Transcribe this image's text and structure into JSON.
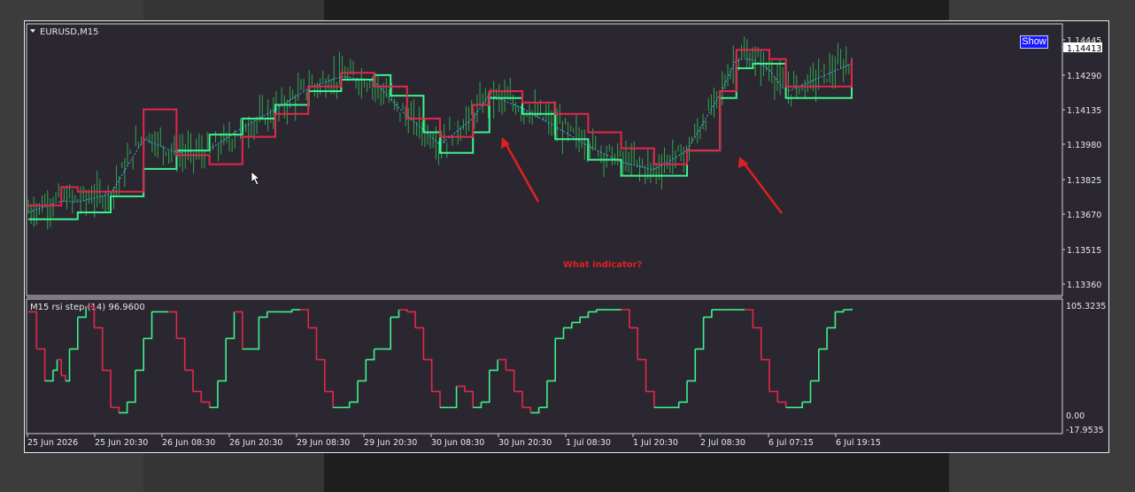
{
  "window": {
    "symbol_label": "EURUSD,M15",
    "indicator_label": "M15 rsi step (14) 96.9600",
    "show_button": "Show",
    "annotation_text": "What indicator?"
  },
  "colors": {
    "background": "#2b2730",
    "candle": "#2fa84f",
    "green_line": "#3cf28c",
    "red_line": "#e0284a",
    "annotation": "#e02020"
  },
  "chart_data": [
    {
      "type": "line",
      "title": "EURUSD,M15",
      "y_ticks": [
        "1.14445",
        "1.14413",
        "1.14290",
        "1.14135",
        "1.13980",
        "1.13825",
        "1.13670",
        "1.13515",
        "1.13360"
      ],
      "ylim": [
        1.1329,
        1.1447
      ],
      "current_price": "1.14413",
      "series": [
        {
          "color": "#3cf28c",
          "style": "step",
          "x": [
            0,
            0.06,
            0.1,
            0.14,
            0.18,
            0.22,
            0.26,
            0.3,
            0.34,
            0.38,
            0.42,
            0.44,
            0.48,
            0.5,
            0.54,
            0.56,
            0.6,
            0.64,
            0.68,
            0.72,
            0.76,
            0.8,
            0.84,
            0.86,
            0.88,
            0.92,
            1.0
          ],
          "y": [
            1.1362,
            1.1365,
            1.1372,
            1.1384,
            1.1392,
            1.1399,
            1.1406,
            1.1412,
            1.1418,
            1.1423,
            1.1425,
            1.1416,
            1.14,
            1.1391,
            1.14,
            1.1415,
            1.1408,
            1.1397,
            1.1388,
            1.1381,
            1.1381,
            1.1392,
            1.1415,
            1.1428,
            1.143,
            1.1415,
            1.1428
          ]
        },
        {
          "color": "#e0284a",
          "style": "step",
          "x": [
            0,
            0.04,
            0.06,
            0.1,
            0.14,
            0.18,
            0.22,
            0.26,
            0.3,
            0.34,
            0.38,
            0.42,
            0.46,
            0.5,
            0.54,
            0.56,
            0.6,
            0.64,
            0.68,
            0.72,
            0.76,
            0.8,
            0.84,
            0.86,
            0.9,
            0.92,
            1.0
          ],
          "y": [
            1.1368,
            1.1376,
            1.1374,
            1.1374,
            1.141,
            1.139,
            1.1386,
            1.1398,
            1.1408,
            1.142,
            1.1426,
            1.142,
            1.1406,
            1.1398,
            1.1412,
            1.1418,
            1.1413,
            1.1408,
            1.14,
            1.1393,
            1.1386,
            1.1392,
            1.1418,
            1.1436,
            1.1432,
            1.142,
            1.1432
          ]
        }
      ]
    },
    {
      "type": "line",
      "title": "M15 rsi step (14) 96.9600",
      "y_ticks": [
        "105.3235",
        "0.00",
        "-17.9535"
      ],
      "ylim": [
        -17.9535,
        105.3235
      ],
      "x_ticks": [
        "25 Jun 2026",
        "25 Jun 20:30",
        "26 Jun 08:30",
        "26 Jun 20:30",
        "29 Jun 08:30",
        "29 Jun 20:30",
        "30 Jun 08:30",
        "30 Jun 20:30",
        "1 Jul 08:30",
        "1 Jul 20:30",
        "2 Jul 08:30",
        "6 Jul 07:15",
        "6 Jul 19:15"
      ],
      "series": [
        {
          "style": "step",
          "colors_up_down": [
            "#3cf28c",
            "#e0284a"
          ],
          "x": [
            0,
            0.01,
            0.02,
            0.03,
            0.035,
            0.04,
            0.045,
            0.05,
            0.06,
            0.07,
            0.08,
            0.09,
            0.1,
            0.11,
            0.12,
            0.13,
            0.14,
            0.15,
            0.16,
            0.17,
            0.18,
            0.19,
            0.2,
            0.21,
            0.22,
            0.23,
            0.24,
            0.25,
            0.26,
            0.27,
            0.28,
            0.29,
            0.3,
            0.31,
            0.32,
            0.33,
            0.34,
            0.35,
            0.36,
            0.37,
            0.38,
            0.39,
            0.4,
            0.41,
            0.42,
            0.43,
            0.44,
            0.45,
            0.46,
            0.47,
            0.48,
            0.49,
            0.5,
            0.51,
            0.52,
            0.53,
            0.54,
            0.55,
            0.56,
            0.57,
            0.58,
            0.59,
            0.6,
            0.61,
            0.62,
            0.63,
            0.64,
            0.65,
            0.66,
            0.67,
            0.68,
            0.69,
            0.7,
            0.71,
            0.72,
            0.73,
            0.74,
            0.75,
            0.76,
            0.77,
            0.78,
            0.79,
            0.8,
            0.81,
            0.82,
            0.83,
            0.84,
            0.85,
            0.86,
            0.87,
            0.88,
            0.89,
            0.9,
            0.91,
            0.92,
            0.93,
            0.94,
            0.95,
            0.96,
            0.97,
            0.98,
            0.99,
            1.0
          ],
          "y": [
            95,
            60,
            30,
            40,
            50,
            35,
            30,
            60,
            90,
            100,
            80,
            40,
            5,
            0,
            10,
            40,
            70,
            95,
            95,
            95,
            70,
            40,
            20,
            10,
            5,
            30,
            70,
            95,
            60,
            60,
            90,
            95,
            95,
            95,
            97,
            97,
            80,
            50,
            20,
            5,
            5,
            10,
            30,
            50,
            60,
            60,
            90,
            97,
            95,
            80,
            50,
            20,
            5,
            5,
            25,
            20,
            5,
            10,
            40,
            50,
            40,
            20,
            5,
            0,
            5,
            30,
            70,
            80,
            85,
            90,
            95,
            97,
            97,
            97,
            97,
            80,
            50,
            20,
            5,
            5,
            5,
            10,
            30,
            60,
            90,
            97,
            97,
            97,
            97,
            97,
            80,
            50,
            20,
            10,
            5,
            5,
            10,
            30,
            60,
            80,
            95,
            97,
            98
          ]
        }
      ]
    }
  ]
}
